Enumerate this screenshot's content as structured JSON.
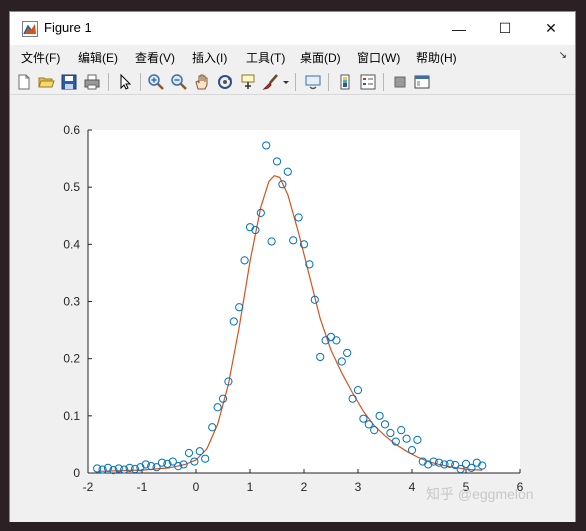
{
  "window": {
    "title": "Figure 1",
    "controls": {
      "minimize": "—",
      "maximize": "☐",
      "close": "✕"
    }
  },
  "menu": {
    "items": [
      "文件(F)",
      "编辑(E)",
      "查看(V)",
      "插入(I)",
      "工具(T)",
      "桌面(D)",
      "窗口(W)",
      "帮助(H)"
    ],
    "more_arrow": "↘"
  },
  "toolbar": {
    "icons": [
      "new-figure-icon",
      "open-icon",
      "save-icon",
      "print-icon",
      "select-arrow-icon",
      "zoom-in-icon",
      "zoom-out-icon",
      "pan-hand-icon",
      "rotate-3d-icon",
      "data-cursor-icon",
      "brush-icon",
      "brush-dropdown-icon",
      "link-plot-icon",
      "colorbar-icon",
      "legend-icon",
      "hide-plot-tools-icon",
      "show-plot-tools-icon"
    ]
  },
  "watermark": "知乎 @eggmelon",
  "colors": {
    "fit_line": "#d95319",
    "markers": "#0072bd",
    "axes_bg": "#ffffff"
  },
  "chart_data": {
    "type": "scatter",
    "title": "",
    "xlabel": "",
    "ylabel": "",
    "xlim": [
      -2,
      6
    ],
    "ylim": [
      0,
      0.6
    ],
    "xticks": [
      -2,
      -1,
      0,
      1,
      2,
      3,
      4,
      5,
      6
    ],
    "yticks": [
      0,
      0.1,
      0.2,
      0.3,
      0.4,
      0.5,
      0.6
    ],
    "grid": false,
    "legend": "none",
    "series": [
      {
        "kind": "scatter",
        "marker": "open-circle",
        "points": [
          [
            -1.83,
            0.008
          ],
          [
            -1.73,
            0.006
          ],
          [
            -1.63,
            0.009
          ],
          [
            -1.53,
            0.005
          ],
          [
            -1.43,
            0.008
          ],
          [
            -1.33,
            0.006
          ],
          [
            -1.23,
            0.009
          ],
          [
            -1.13,
            0.007
          ],
          [
            -1.03,
            0.01
          ],
          [
            -0.93,
            0.015
          ],
          [
            -0.83,
            0.012
          ],
          [
            -0.73,
            0.01
          ],
          [
            -0.63,
            0.018
          ],
          [
            -0.53,
            0.016
          ],
          [
            -0.43,
            0.02
          ],
          [
            -0.33,
            0.012
          ],
          [
            -0.23,
            0.015
          ],
          [
            -0.13,
            0.035
          ],
          [
            -0.03,
            0.02
          ],
          [
            0.07,
            0.038
          ],
          [
            0.17,
            0.025
          ],
          [
            0.3,
            0.08
          ],
          [
            0.4,
            0.115
          ],
          [
            0.5,
            0.13
          ],
          [
            0.6,
            0.16
          ],
          [
            0.7,
            0.265
          ],
          [
            0.8,
            0.29
          ],
          [
            0.9,
            0.372
          ],
          [
            1.0,
            0.43
          ],
          [
            1.1,
            0.425
          ],
          [
            1.2,
            0.455
          ],
          [
            1.3,
            0.573
          ],
          [
            1.4,
            0.405
          ],
          [
            1.5,
            0.545
          ],
          [
            1.6,
            0.505
          ],
          [
            1.7,
            0.527
          ],
          [
            1.8,
            0.407
          ],
          [
            1.9,
            0.447
          ],
          [
            2.0,
            0.4
          ],
          [
            2.1,
            0.365
          ],
          [
            2.2,
            0.303
          ],
          [
            2.3,
            0.203
          ],
          [
            2.4,
            0.232
          ],
          [
            2.5,
            0.238
          ],
          [
            2.6,
            0.232
          ],
          [
            2.7,
            0.195
          ],
          [
            2.8,
            0.21
          ],
          [
            2.9,
            0.13
          ],
          [
            3.0,
            0.145
          ],
          [
            3.1,
            0.095
          ],
          [
            3.2,
            0.085
          ],
          [
            3.3,
            0.075
          ],
          [
            3.4,
            0.1
          ],
          [
            3.5,
            0.085
          ],
          [
            3.6,
            0.07
          ],
          [
            3.7,
            0.055
          ],
          [
            3.8,
            0.075
          ],
          [
            3.9,
            0.06
          ],
          [
            4.0,
            0.04
          ],
          [
            4.1,
            0.058
          ],
          [
            4.2,
            0.02
          ],
          [
            4.3,
            0.015
          ],
          [
            4.4,
            0.02
          ],
          [
            4.5,
            0.018
          ],
          [
            4.6,
            0.015
          ],
          [
            4.7,
            0.016
          ],
          [
            4.8,
            0.014
          ],
          [
            4.9,
            0.007
          ],
          [
            5.0,
            0.016
          ],
          [
            5.1,
            0.009
          ],
          [
            5.2,
            0.018
          ],
          [
            5.3,
            0.013
          ]
        ]
      },
      {
        "kind": "line",
        "points": [
          [
            -1.8,
            0.003
          ],
          [
            -1.0,
            0.005
          ],
          [
            -0.5,
            0.009
          ],
          [
            -0.2,
            0.015
          ],
          [
            0.0,
            0.023
          ],
          [
            0.2,
            0.042
          ],
          [
            0.4,
            0.085
          ],
          [
            0.6,
            0.155
          ],
          [
            0.8,
            0.255
          ],
          [
            1.0,
            0.37
          ],
          [
            1.2,
            0.465
          ],
          [
            1.35,
            0.51
          ],
          [
            1.45,
            0.52
          ],
          [
            1.55,
            0.517
          ],
          [
            1.7,
            0.487
          ],
          [
            1.9,
            0.42
          ],
          [
            2.1,
            0.345
          ],
          [
            2.3,
            0.27
          ],
          [
            2.5,
            0.215
          ],
          [
            2.7,
            0.175
          ],
          [
            2.9,
            0.14
          ],
          [
            3.1,
            0.108
          ],
          [
            3.3,
            0.083
          ],
          [
            3.5,
            0.065
          ],
          [
            3.7,
            0.05
          ],
          [
            3.9,
            0.038
          ],
          [
            4.1,
            0.028
          ],
          [
            4.3,
            0.02
          ],
          [
            4.5,
            0.015
          ],
          [
            4.7,
            0.011
          ],
          [
            4.9,
            0.008
          ],
          [
            5.1,
            0.006
          ],
          [
            5.3,
            0.005
          ]
        ]
      }
    ]
  }
}
